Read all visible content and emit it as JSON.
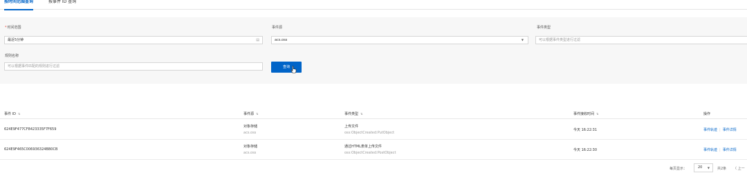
{
  "tabs": [
    {
      "label": "按时间范围查询"
    },
    {
      "label": "按事件 ID 查询"
    }
  ],
  "filters": {
    "time_range": {
      "label": "时间范围",
      "required_mark": "*",
      "value": "最近5分钟"
    },
    "event_source": {
      "label": "事件源",
      "value": "acs.oss"
    },
    "event_type": {
      "label": "事件类型",
      "placeholder": "可以根据事件类型进行过滤"
    },
    "rule_name": {
      "label": "规则名称",
      "placeholder": "可以根据事件匹配的规则进行过滤"
    },
    "query_button": "查询"
  },
  "table": {
    "columns": [
      "事件 ID",
      "事件源",
      "事件类型",
      "事件接收时间",
      "操作"
    ],
    "sort_icon": "⇅",
    "rows": [
      {
        "id": "624E9F477CF8423335F7F659",
        "source_name": "对象存储",
        "source_code": "acs.oss",
        "type_name": "上传文件",
        "type_code": "oss:ObjectCreated:PutObject",
        "time": "今天 16:22:31",
        "action_trace": "事件轨迹",
        "action_detail": "事件详情"
      },
      {
        "id": "624E9F465C006936324BB0CB",
        "source_name": "对象存储",
        "source_code": "acs.oss",
        "type_name": "通过HTML表单上传文件",
        "type_code": "oss:ObjectCreated:PostObject",
        "time": "今天 16:22:30",
        "action_trace": "事件轨迹",
        "action_detail": "事件详情"
      }
    ]
  },
  "pagination": {
    "page_size_label": "每页显示：",
    "page_size": "20",
    "total": "共2条",
    "prev": "〈 上一"
  },
  "icons": {
    "calendar": "calendar-icon",
    "dropdown": "chevron-down-icon",
    "sort": "sort-icon",
    "cursor": "hand-pointer-icon"
  },
  "colors": {
    "primary": "#0064c8",
    "required": "#e84738",
    "filter_bg": "#f7f7f7"
  }
}
